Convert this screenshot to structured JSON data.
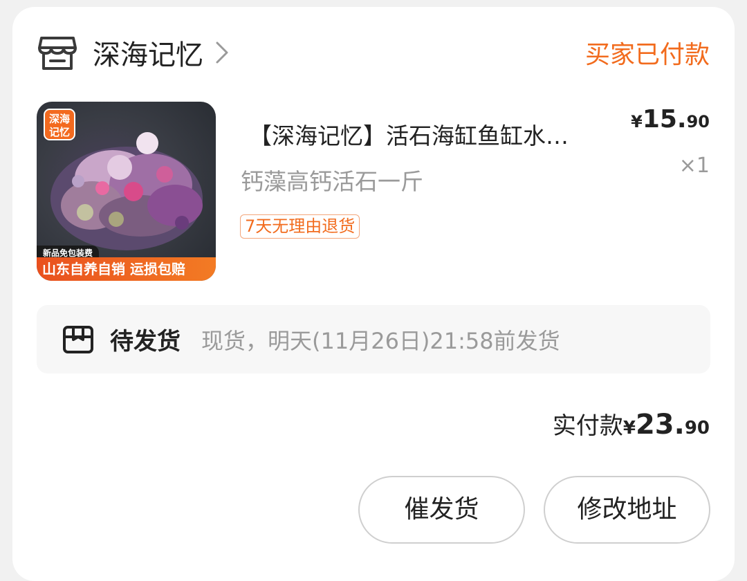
{
  "shop": {
    "name": "深海记忆",
    "icon": "store-icon",
    "status": "买家已付款"
  },
  "product": {
    "title": "【深海记忆】活石海缸鱼缸水…",
    "subtitle": "钙藻高钙活石一斤",
    "price_currency": "¥",
    "price_int": "15.",
    "price_dec": "90",
    "quantity": "×1",
    "return_tag": "7天无理由退货",
    "image": {
      "badge": "深海记忆",
      "badge_line1": "深海",
      "badge_line2": "记忆",
      "promo_small": "新品免包装费",
      "promo_bar": "山东自养自销 运损包赔"
    }
  },
  "shipping": {
    "icon": "package-icon",
    "status": "待发货",
    "detail": "现货，明天(11月26日)21:58前发货"
  },
  "total": {
    "label": "实付款",
    "currency": "¥",
    "int": "23.",
    "dec": "90"
  },
  "buttons": {
    "urge": "催发货",
    "change_address": "修改地址"
  },
  "colors": {
    "accent": "#f26b1d",
    "muted_text": "#9a9a9a"
  }
}
